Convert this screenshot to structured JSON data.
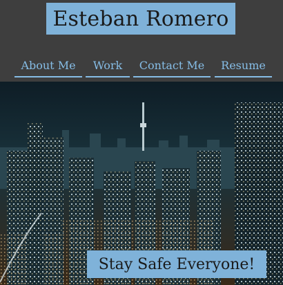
{
  "site": {
    "title": "Esteban Romero"
  },
  "nav": {
    "items": [
      {
        "label": "About Me"
      },
      {
        "label": "Work"
      },
      {
        "label": "Contact Me"
      },
      {
        "label": "Resume"
      }
    ]
  },
  "hero": {
    "caption": "Stay Safe Everyone!"
  },
  "colors": {
    "header_bg": "#3e3e3e",
    "accent": "#7fb2d9",
    "nav_text": "#86bde6"
  }
}
